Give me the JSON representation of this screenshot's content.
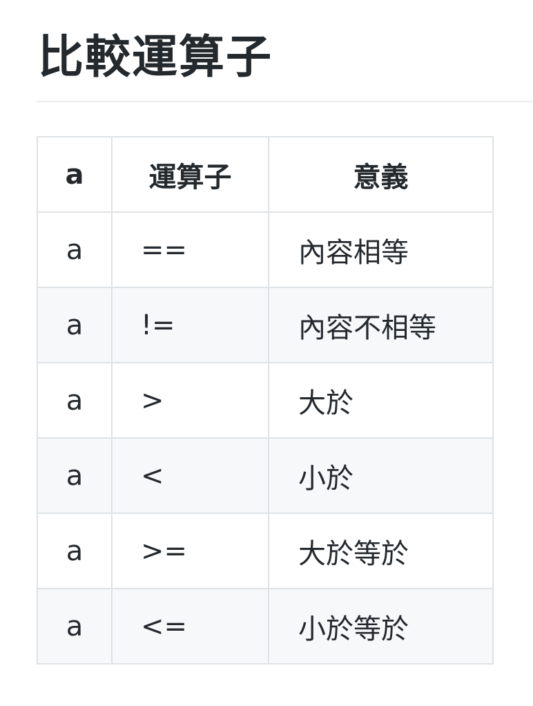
{
  "heading": "比較運算子",
  "table": {
    "headers": [
      "a",
      "運算子",
      "意義"
    ],
    "rows": [
      [
        "a",
        "==",
        "內容相等"
      ],
      [
        "a",
        "!=",
        "內容不相等"
      ],
      [
        "a",
        ">",
        "大於"
      ],
      [
        "a",
        "<",
        "小於"
      ],
      [
        "a",
        ">=",
        "大於等於"
      ],
      [
        "a",
        "<=",
        "小於等於"
      ]
    ]
  }
}
